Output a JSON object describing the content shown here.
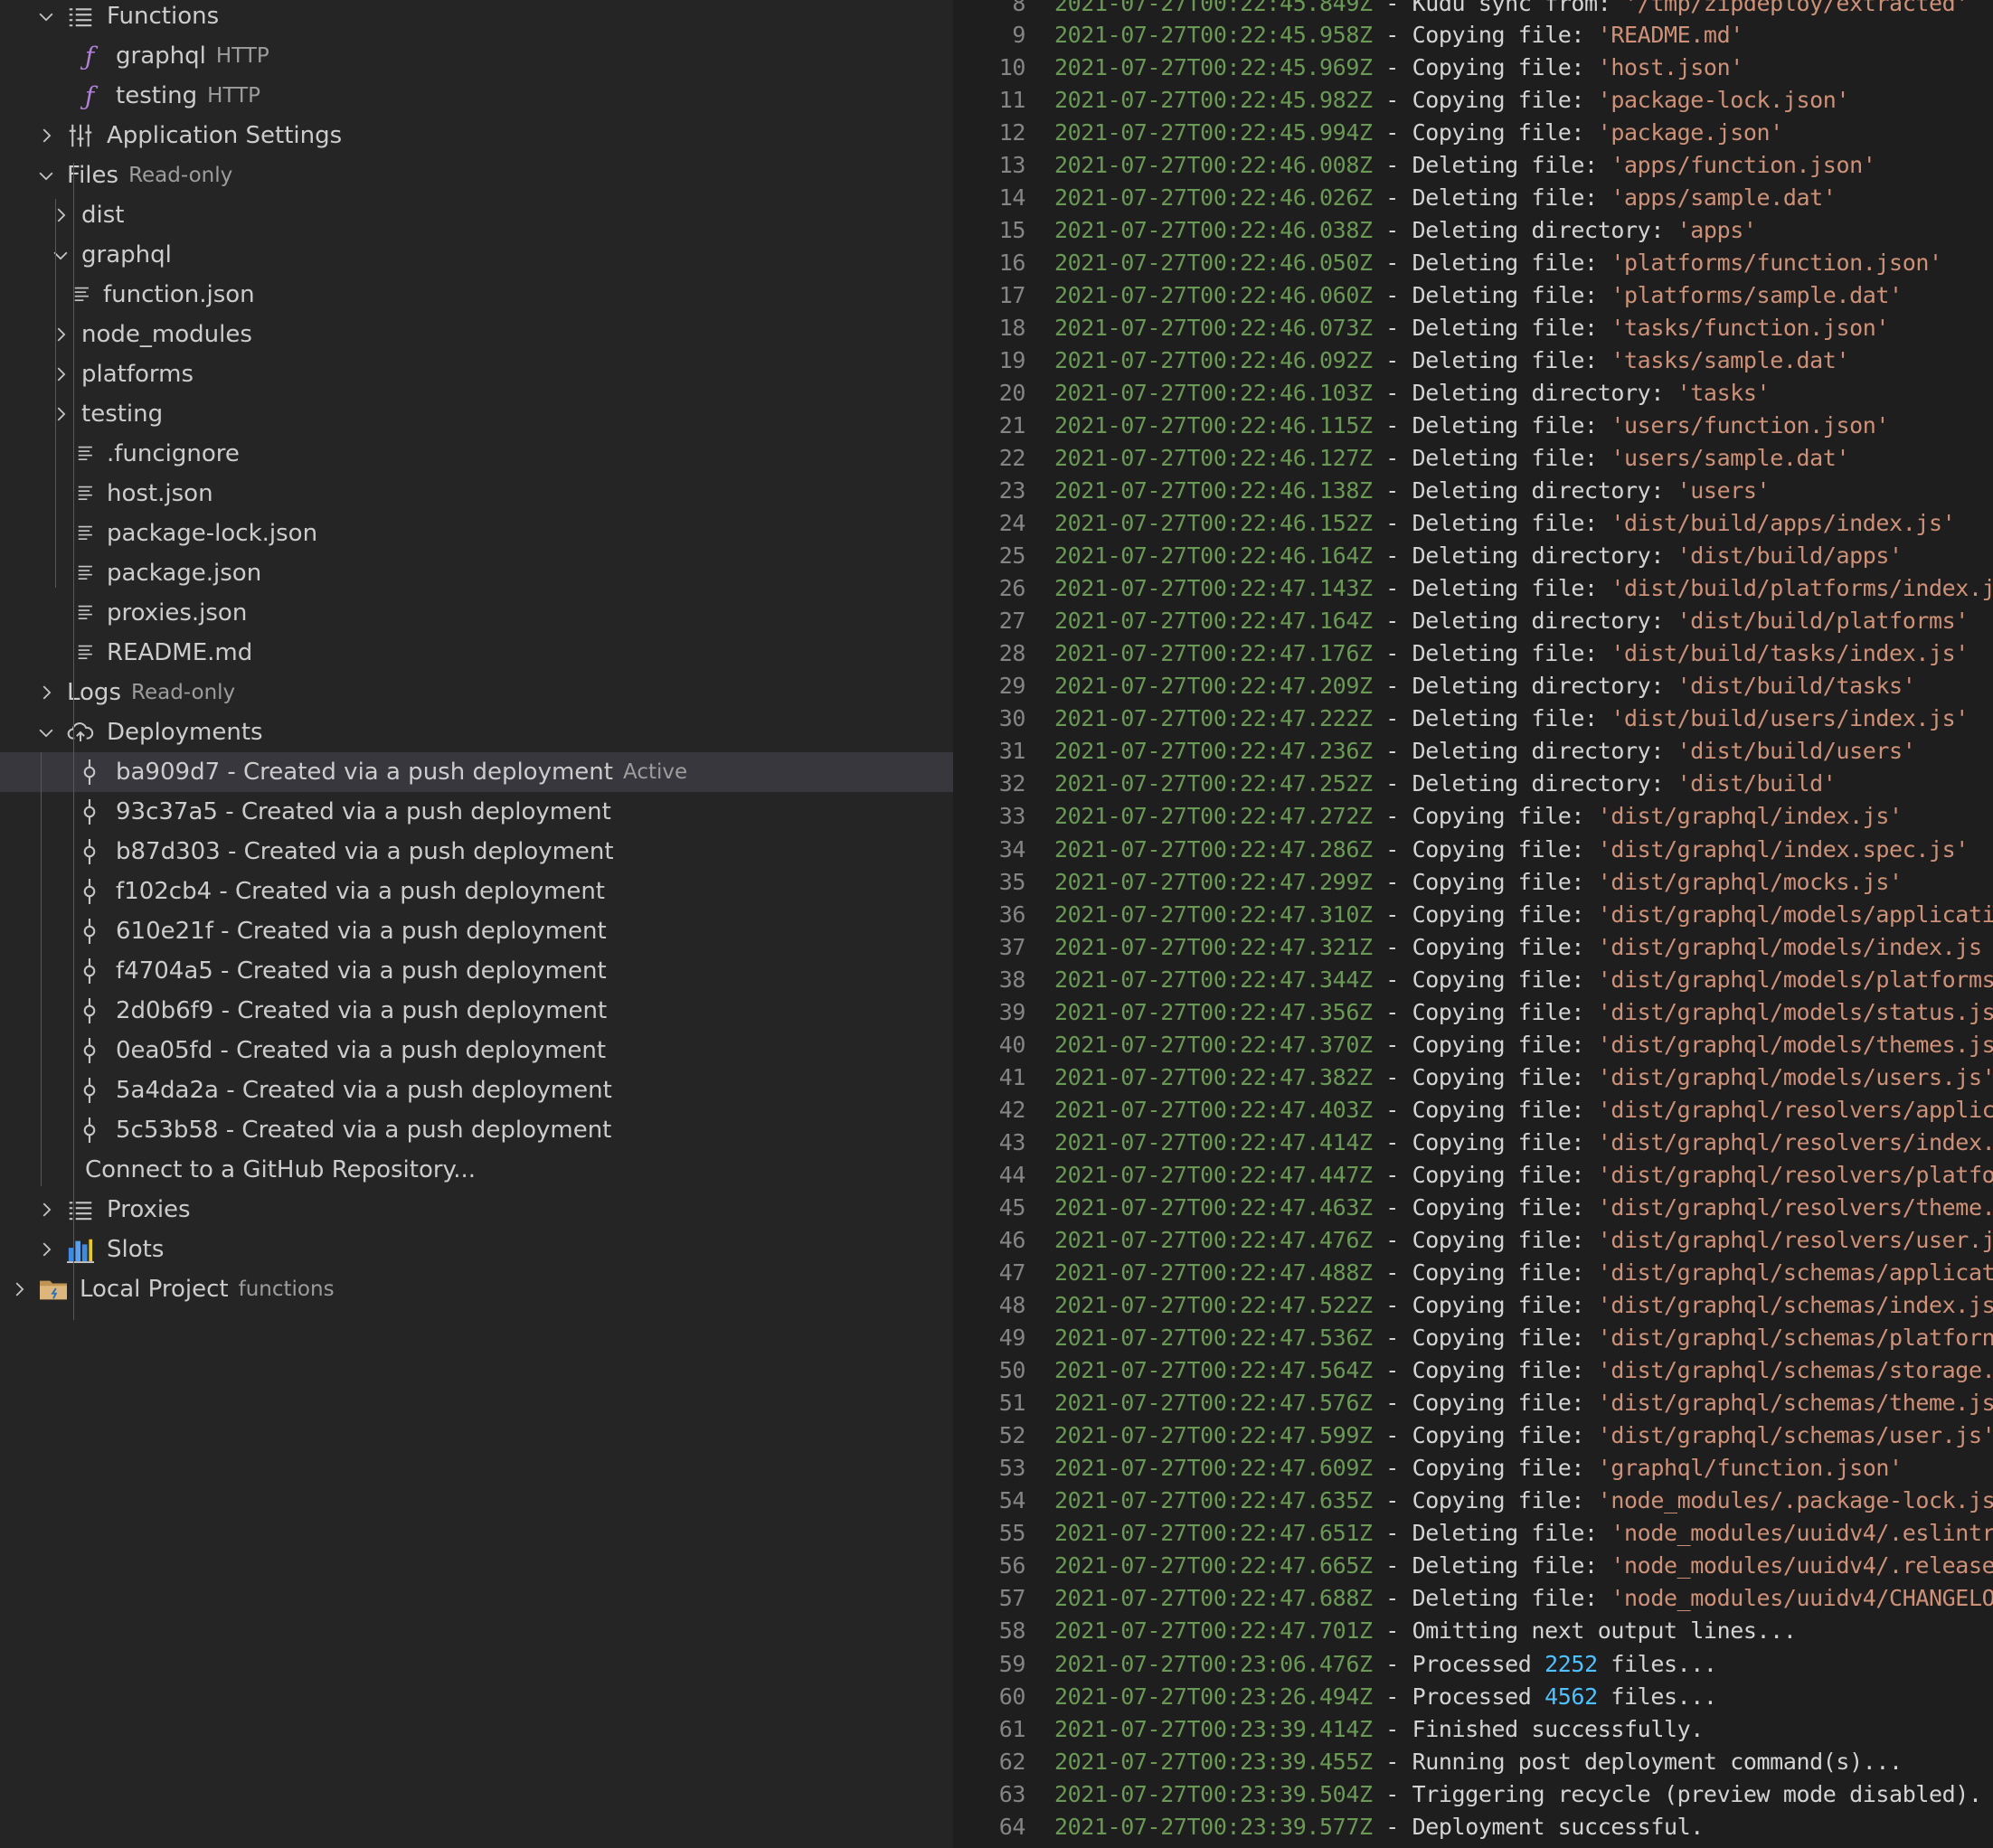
{
  "colors": {
    "sidebar_bg": "#252526",
    "editor_bg": "#1e1e1e",
    "selected_row": "#37373d",
    "timestamp": "#6a9955",
    "string": "#ce9178",
    "number": "#4fc1ff",
    "function_icon": "#b180d7"
  },
  "tree": [
    {
      "indent": 0,
      "chevron": "down",
      "icon": "list-icon",
      "label": "Functions"
    },
    {
      "indent": 1,
      "chevron": "none",
      "icon": "function-icon",
      "label": "graphql",
      "desc": "HTTP"
    },
    {
      "indent": 1,
      "chevron": "none",
      "icon": "function-icon",
      "label": "testing",
      "desc": "HTTP"
    },
    {
      "indent": 0,
      "chevron": "right",
      "icon": "settings-sliders-icon",
      "label": "Application Settings"
    },
    {
      "indent": 0,
      "chevron": "down",
      "icon": "none",
      "label": "Files",
      "desc": "Read-only"
    },
    {
      "indent": 1,
      "chevron": "right",
      "icon": "none",
      "label": "dist"
    },
    {
      "indent": 1,
      "chevron": "down",
      "icon": "none",
      "label": "graphql"
    },
    {
      "indent": 2,
      "chevron": "none",
      "icon": "file-lines-icon",
      "label": "function.json"
    },
    {
      "indent": 1,
      "chevron": "right",
      "icon": "none",
      "label": "node_modules"
    },
    {
      "indent": 1,
      "chevron": "right",
      "icon": "none",
      "label": "platforms"
    },
    {
      "indent": 1,
      "chevron": "right",
      "icon": "none",
      "label": "testing"
    },
    {
      "indent": 1,
      "chevron": "none",
      "icon": "file-lines-icon",
      "label": ".funcignore"
    },
    {
      "indent": 1,
      "chevron": "none",
      "icon": "file-lines-icon",
      "label": "host.json"
    },
    {
      "indent": 1,
      "chevron": "none",
      "icon": "file-lines-icon",
      "label": "package-lock.json"
    },
    {
      "indent": 1,
      "chevron": "none",
      "icon": "file-lines-icon",
      "label": "package.json"
    },
    {
      "indent": 1,
      "chevron": "none",
      "icon": "file-lines-icon",
      "label": "proxies.json"
    },
    {
      "indent": 1,
      "chevron": "none",
      "icon": "file-lines-icon",
      "label": "README.md"
    },
    {
      "indent": 0,
      "chevron": "right",
      "icon": "none",
      "label": "Logs",
      "desc": "Read-only"
    },
    {
      "indent": 0,
      "chevron": "down",
      "icon": "cloud-upload-icon",
      "label": "Deployments"
    },
    {
      "indent": 1,
      "chevron": "none",
      "icon": "git-commit-icon",
      "label": "ba909d7 - Created via a push deployment",
      "desc": "Active",
      "selected": true
    },
    {
      "indent": 1,
      "chevron": "none",
      "icon": "git-commit-icon",
      "label": "93c37a5 - Created via a push deployment"
    },
    {
      "indent": 1,
      "chevron": "none",
      "icon": "git-commit-icon",
      "label": "b87d303 - Created via a push deployment"
    },
    {
      "indent": 1,
      "chevron": "none",
      "icon": "git-commit-icon",
      "label": "f102cb4 - Created via a push deployment"
    },
    {
      "indent": 1,
      "chevron": "none",
      "icon": "git-commit-icon",
      "label": "610e21f - Created via a push deployment"
    },
    {
      "indent": 1,
      "chevron": "none",
      "icon": "git-commit-icon",
      "label": "f4704a5 - Created via a push deployment"
    },
    {
      "indent": 1,
      "chevron": "none",
      "icon": "git-commit-icon",
      "label": "2d0b6f9 - Created via a push deployment"
    },
    {
      "indent": 1,
      "chevron": "none",
      "icon": "git-commit-icon",
      "label": "0ea05fd - Created via a push deployment"
    },
    {
      "indent": 1,
      "chevron": "none",
      "icon": "git-commit-icon",
      "label": "5a4da2a - Created via a push deployment"
    },
    {
      "indent": 1,
      "chevron": "none",
      "icon": "git-commit-icon",
      "label": "5c53b58 - Created via a push deployment"
    },
    {
      "indent": 1,
      "chevron": "none",
      "icon": "none",
      "label": "Connect to a GitHub Repository..."
    },
    {
      "indent": 0,
      "chevron": "right",
      "icon": "list-icon",
      "label": "Proxies"
    },
    {
      "indent": 0,
      "chevron": "right",
      "icon": "slots-icon",
      "label": "Slots"
    },
    {
      "indent": -1,
      "chevron": "right",
      "icon": "folder-icon",
      "label": "Local Project",
      "desc": "functions"
    }
  ],
  "log": {
    "partial_first_line": {
      "n": "8",
      "ts": "2021-07-27T00:22:45.849Z",
      "msg": " - Kudu sync from: ",
      "str": "'/tmp/zipdeploy/extracted'"
    },
    "lines": [
      {
        "n": "9",
        "ts": "2021-07-27T00:22:45.958Z",
        "msg": " - Copying file: ",
        "str": "'README.md'"
      },
      {
        "n": "10",
        "ts": "2021-07-27T00:22:45.969Z",
        "msg": " - Copying file: ",
        "str": "'host.json'"
      },
      {
        "n": "11",
        "ts": "2021-07-27T00:22:45.982Z",
        "msg": " - Copying file: ",
        "str": "'package-lock.json'"
      },
      {
        "n": "12",
        "ts": "2021-07-27T00:22:45.994Z",
        "msg": " - Copying file: ",
        "str": "'package.json'"
      },
      {
        "n": "13",
        "ts": "2021-07-27T00:22:46.008Z",
        "msg": " - Deleting file: ",
        "str": "'apps/function.json'"
      },
      {
        "n": "14",
        "ts": "2021-07-27T00:22:46.026Z",
        "msg": " - Deleting file: ",
        "str": "'apps/sample.dat'"
      },
      {
        "n": "15",
        "ts": "2021-07-27T00:22:46.038Z",
        "msg": " - Deleting directory: ",
        "str": "'apps'"
      },
      {
        "n": "16",
        "ts": "2021-07-27T00:22:46.050Z",
        "msg": " - Deleting file: ",
        "str": "'platforms/function.json'"
      },
      {
        "n": "17",
        "ts": "2021-07-27T00:22:46.060Z",
        "msg": " - Deleting file: ",
        "str": "'platforms/sample.dat'"
      },
      {
        "n": "18",
        "ts": "2021-07-27T00:22:46.073Z",
        "msg": " - Deleting file: ",
        "str": "'tasks/function.json'"
      },
      {
        "n": "19",
        "ts": "2021-07-27T00:22:46.092Z",
        "msg": " - Deleting file: ",
        "str": "'tasks/sample.dat'"
      },
      {
        "n": "20",
        "ts": "2021-07-27T00:22:46.103Z",
        "msg": " - Deleting directory: ",
        "str": "'tasks'"
      },
      {
        "n": "21",
        "ts": "2021-07-27T00:22:46.115Z",
        "msg": " - Deleting file: ",
        "str": "'users/function.json'"
      },
      {
        "n": "22",
        "ts": "2021-07-27T00:22:46.127Z",
        "msg": " - Deleting file: ",
        "str": "'users/sample.dat'"
      },
      {
        "n": "23",
        "ts": "2021-07-27T00:22:46.138Z",
        "msg": " - Deleting directory: ",
        "str": "'users'"
      },
      {
        "n": "24",
        "ts": "2021-07-27T00:22:46.152Z",
        "msg": " - Deleting file: ",
        "str": "'dist/build/apps/index.js'"
      },
      {
        "n": "25",
        "ts": "2021-07-27T00:22:46.164Z",
        "msg": " - Deleting directory: ",
        "str": "'dist/build/apps'"
      },
      {
        "n": "26",
        "ts": "2021-07-27T00:22:47.143Z",
        "msg": " - Deleting file: ",
        "str": "'dist/build/platforms/index.j"
      },
      {
        "n": "27",
        "ts": "2021-07-27T00:22:47.164Z",
        "msg": " - Deleting directory: ",
        "str": "'dist/build/platforms'"
      },
      {
        "n": "28",
        "ts": "2021-07-27T00:22:47.176Z",
        "msg": " - Deleting file: ",
        "str": "'dist/build/tasks/index.js'"
      },
      {
        "n": "29",
        "ts": "2021-07-27T00:22:47.209Z",
        "msg": " - Deleting directory: ",
        "str": "'dist/build/tasks'"
      },
      {
        "n": "30",
        "ts": "2021-07-27T00:22:47.222Z",
        "msg": " - Deleting file: ",
        "str": "'dist/build/users/index.js'"
      },
      {
        "n": "31",
        "ts": "2021-07-27T00:22:47.236Z",
        "msg": " - Deleting directory: ",
        "str": "'dist/build/users'"
      },
      {
        "n": "32",
        "ts": "2021-07-27T00:22:47.252Z",
        "msg": " - Deleting directory: ",
        "str": "'dist/build'"
      },
      {
        "n": "33",
        "ts": "2021-07-27T00:22:47.272Z",
        "msg": " - Copying file: ",
        "str": "'dist/graphql/index.js'"
      },
      {
        "n": "34",
        "ts": "2021-07-27T00:22:47.286Z",
        "msg": " - Copying file: ",
        "str": "'dist/graphql/index.spec.js'"
      },
      {
        "n": "35",
        "ts": "2021-07-27T00:22:47.299Z",
        "msg": " - Copying file: ",
        "str": "'dist/graphql/mocks.js'"
      },
      {
        "n": "36",
        "ts": "2021-07-27T00:22:47.310Z",
        "msg": " - Copying file: ",
        "str": "'dist/graphql/models/applicati"
      },
      {
        "n": "37",
        "ts": "2021-07-27T00:22:47.321Z",
        "msg": " - Copying file: ",
        "str": "'dist/graphql/models/index.js"
      },
      {
        "n": "38",
        "ts": "2021-07-27T00:22:47.344Z",
        "msg": " - Copying file: ",
        "str": "'dist/graphql/models/platforms"
      },
      {
        "n": "39",
        "ts": "2021-07-27T00:22:47.356Z",
        "msg": " - Copying file: ",
        "str": "'dist/graphql/models/status.js"
      },
      {
        "n": "40",
        "ts": "2021-07-27T00:22:47.370Z",
        "msg": " - Copying file: ",
        "str": "'dist/graphql/models/themes.js"
      },
      {
        "n": "41",
        "ts": "2021-07-27T00:22:47.382Z",
        "msg": " - Copying file: ",
        "str": "'dist/graphql/models/users.js'"
      },
      {
        "n": "42",
        "ts": "2021-07-27T00:22:47.403Z",
        "msg": " - Copying file: ",
        "str": "'dist/graphql/resolvers/applic"
      },
      {
        "n": "43",
        "ts": "2021-07-27T00:22:47.414Z",
        "msg": " - Copying file: ",
        "str": "'dist/graphql/resolvers/index."
      },
      {
        "n": "44",
        "ts": "2021-07-27T00:22:47.447Z",
        "msg": " - Copying file: ",
        "str": "'dist/graphql/resolvers/platfo"
      },
      {
        "n": "45",
        "ts": "2021-07-27T00:22:47.463Z",
        "msg": " - Copying file: ",
        "str": "'dist/graphql/resolvers/theme."
      },
      {
        "n": "46",
        "ts": "2021-07-27T00:22:47.476Z",
        "msg": " - Copying file: ",
        "str": "'dist/graphql/resolvers/user.j"
      },
      {
        "n": "47",
        "ts": "2021-07-27T00:22:47.488Z",
        "msg": " - Copying file: ",
        "str": "'dist/graphql/schemas/applicat"
      },
      {
        "n": "48",
        "ts": "2021-07-27T00:22:47.522Z",
        "msg": " - Copying file: ",
        "str": "'dist/graphql/schemas/index.js"
      },
      {
        "n": "49",
        "ts": "2021-07-27T00:22:47.536Z",
        "msg": " - Copying file: ",
        "str": "'dist/graphql/schemas/platforn"
      },
      {
        "n": "50",
        "ts": "2021-07-27T00:22:47.564Z",
        "msg": " - Copying file: ",
        "str": "'dist/graphql/schemas/storage."
      },
      {
        "n": "51",
        "ts": "2021-07-27T00:22:47.576Z",
        "msg": " - Copying file: ",
        "str": "'dist/graphql/schemas/theme.js"
      },
      {
        "n": "52",
        "ts": "2021-07-27T00:22:47.599Z",
        "msg": " - Copying file: ",
        "str": "'dist/graphql/schemas/user.js'"
      },
      {
        "n": "53",
        "ts": "2021-07-27T00:22:47.609Z",
        "msg": " - Copying file: ",
        "str": "'graphql/function.json'"
      },
      {
        "n": "54",
        "ts": "2021-07-27T00:22:47.635Z",
        "msg": " - Copying file: ",
        "str": "'node_modules/.package-lock.js"
      },
      {
        "n": "55",
        "ts": "2021-07-27T00:22:47.651Z",
        "msg": " - Deleting file: ",
        "str": "'node_modules/uuidv4/.eslintr"
      },
      {
        "n": "56",
        "ts": "2021-07-27T00:22:47.665Z",
        "msg": " - Deleting file: ",
        "str": "'node_modules/uuidv4/.release"
      },
      {
        "n": "57",
        "ts": "2021-07-27T00:22:47.688Z",
        "msg": " - Deleting file: ",
        "str": "'node_modules/uuidv4/CHANGELO"
      },
      {
        "n": "58",
        "ts": "2021-07-27T00:22:47.701Z",
        "msg": " - Omitting next output lines..."
      },
      {
        "n": "59",
        "ts": "2021-07-27T00:23:06.476Z",
        "msg": " - Processed ",
        "num": "2252",
        "post": " files..."
      },
      {
        "n": "60",
        "ts": "2021-07-27T00:23:26.494Z",
        "msg": " - Processed ",
        "num": "4562",
        "post": " files..."
      },
      {
        "n": "61",
        "ts": "2021-07-27T00:23:39.414Z",
        "msg": " - Finished successfully."
      },
      {
        "n": "62",
        "ts": "2021-07-27T00:23:39.455Z",
        "msg": " - Running post deployment command(s)..."
      },
      {
        "n": "63",
        "ts": "2021-07-27T00:23:39.504Z",
        "msg": " - Triggering recycle (preview mode disabled)."
      },
      {
        "n": "64",
        "ts": "2021-07-27T00:23:39.577Z",
        "msg": " - Deployment successful."
      }
    ]
  }
}
